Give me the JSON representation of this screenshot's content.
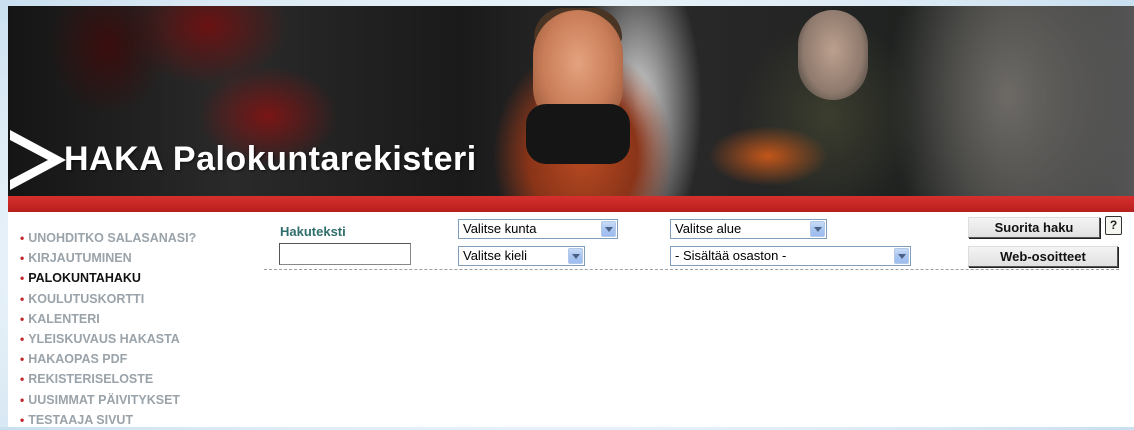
{
  "banner": {
    "title": "HAKA Palokuntarekisteri"
  },
  "menu": {
    "bullet": "•",
    "items": [
      {
        "label": "UNOHDITKO SALASANASI?"
      },
      {
        "label": "KIRJAUTUMINEN"
      },
      {
        "label": "PALOKUNTAHAKU"
      },
      {
        "label": "KOULUTUSKORTTI"
      },
      {
        "label": "KALENTERI"
      },
      {
        "label": "YLEISKUVAUS HAKASTA"
      },
      {
        "label": "HAKAOPAS PDF"
      },
      {
        "label": "REKISTERISELOSTE"
      },
      {
        "label": "UUSIMMAT PÄIVITYKSET"
      },
      {
        "label": "TESTAAJA SIVUT"
      }
    ],
    "active_label": "PALOKUNTAHAKU"
  },
  "search": {
    "text_label": "Hakuteksti",
    "text_value": "",
    "municipality_select": "Valitse kunta",
    "language_select": "Valitse kieli",
    "region_select": "Valitse alue",
    "department_select": "- Sisältää osaston -",
    "submit_label": "Suorita haku",
    "web_label": "Web-osoitteet",
    "help_glyph": "?"
  },
  "colors": {
    "accent_red": "#c0282b",
    "label_teal": "#2f6e6c",
    "menu_grey": "#9aa3aa"
  }
}
